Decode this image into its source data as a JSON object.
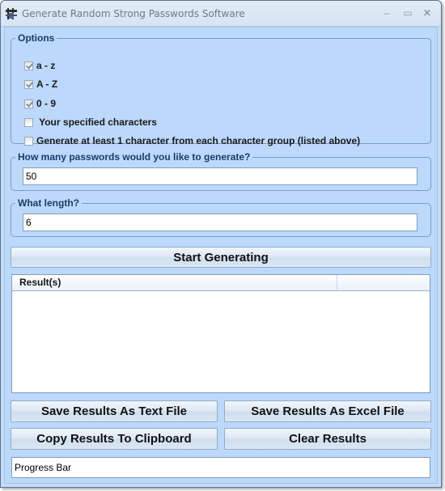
{
  "window": {
    "title": "Generate Random Strong Passwords Software",
    "app_icon": "app-tool-icon",
    "controls": {
      "minimize": "–",
      "maximize": "▭",
      "close": "✕"
    }
  },
  "options": {
    "legend": "Options",
    "items": [
      {
        "label": "a - z",
        "checked": true
      },
      {
        "label": "A - Z",
        "checked": true
      },
      {
        "label": "0 - 9",
        "checked": true
      },
      {
        "label": " Your specified characters",
        "checked": false
      },
      {
        "label": "Generate at least 1 character from each character group (listed above)",
        "checked": false
      }
    ]
  },
  "count_group": {
    "legend": "How many passwords would you like to generate?",
    "value": "50"
  },
  "length_group": {
    "legend": "What length?",
    "value": "6"
  },
  "buttons": {
    "start": "Start Generating",
    "save_text": "Save Results As Text File",
    "save_excel": "Save Results As Excel File",
    "copy": "Copy Results To Clipboard",
    "clear": "Clear Results"
  },
  "results": {
    "columns": [
      "Result(s)",
      ""
    ],
    "rows": []
  },
  "progress": {
    "label": "Progress Bar",
    "value_percent": 0
  }
}
